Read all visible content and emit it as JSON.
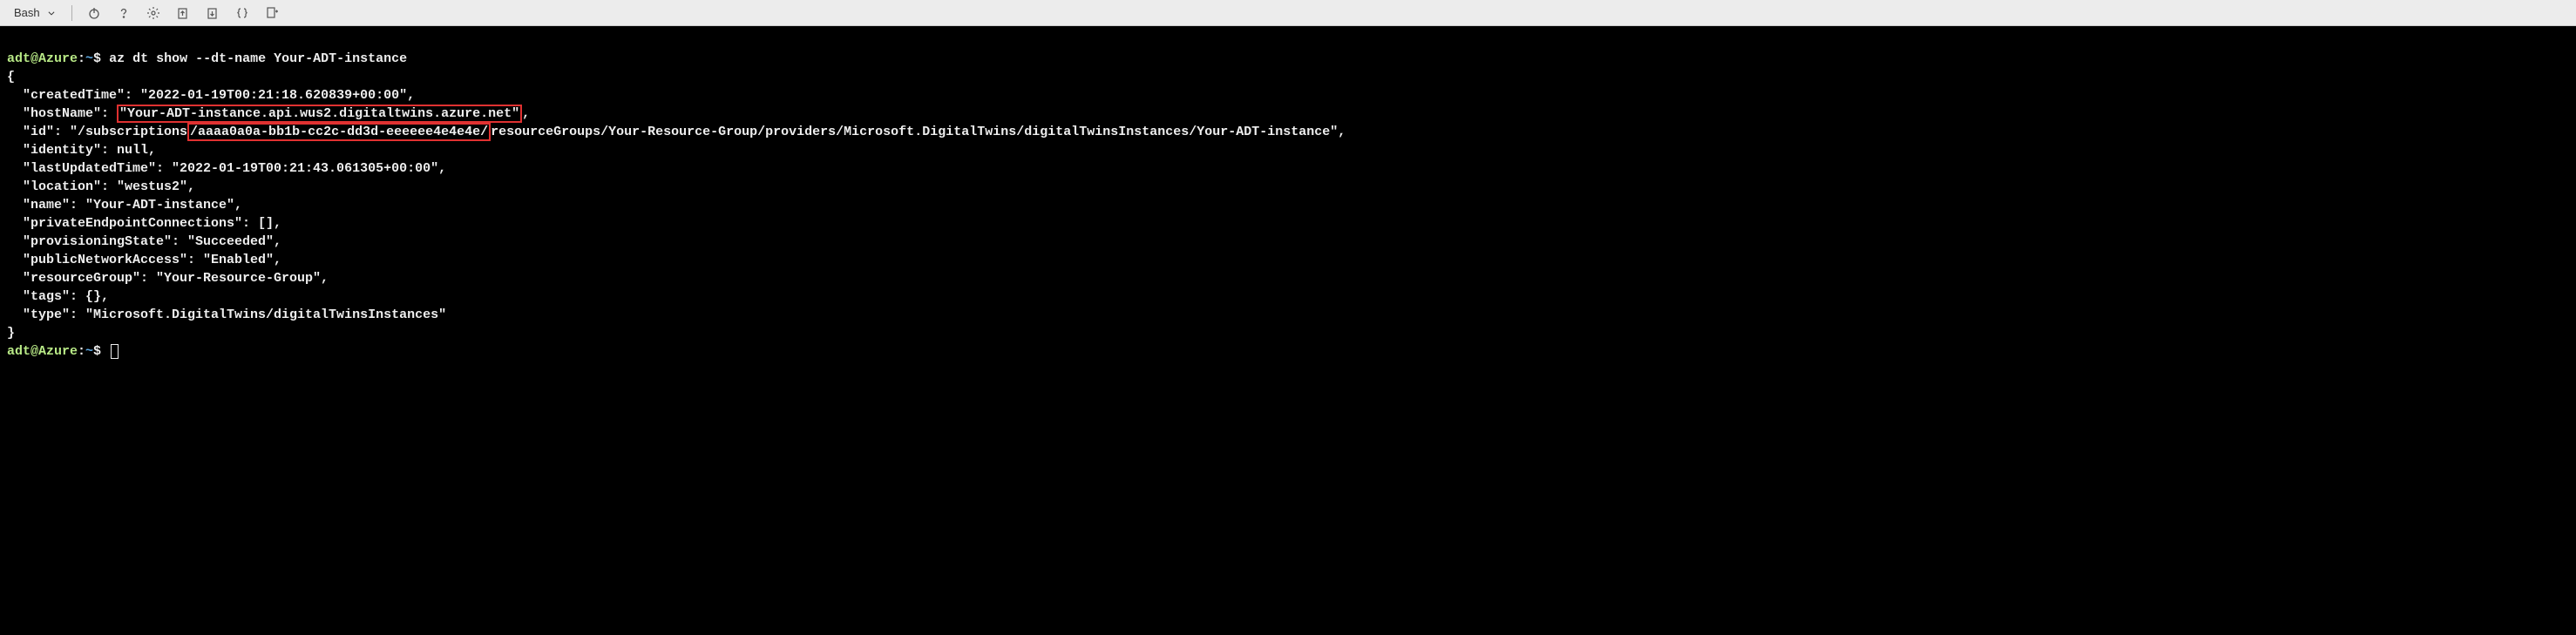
{
  "toolbar": {
    "shell_label": "Bash"
  },
  "prompt": {
    "user": "adt@Azure",
    "path": "~",
    "symbol": "$",
    "colon": ":"
  },
  "command": "az dt show --dt-name Your-ADT-instance",
  "json_open": "{",
  "json_close": "}",
  "lines": {
    "createdTime_key": "  \"createdTime\": ",
    "createdTime_val": "\"2022-01-19T00:21:18.620839+00:00\",",
    "hostName_key": "  \"hostName\": ",
    "hostName_hl": "\"Your-ADT-instance.api.wus2.digitaltwins.azure.net\"",
    "hostName_end": ",",
    "id_key": "  \"id\": \"/subscriptions",
    "id_hl": "/aaaa0a0a-bb1b-cc2c-dd3d-eeeeee4e4e4e/",
    "id_rest": "resourceGroups/Your-Resource-Group/providers/Microsoft.DigitalTwins/digitalTwinsInstances/Your-ADT-instance\",",
    "identity": "  \"identity\": null,",
    "lastUpdatedTime": "  \"lastUpdatedTime\": \"2022-01-19T00:21:43.061305+00:00\",",
    "location": "  \"location\": \"westus2\",",
    "name": "  \"name\": \"Your-ADT-instance\",",
    "privateEndpointConnections": "  \"privateEndpointConnections\": [],",
    "provisioningState": "  \"provisioningState\": \"Succeeded\",",
    "publicNetworkAccess": "  \"publicNetworkAccess\": \"Enabled\",",
    "resourceGroup": "  \"resourceGroup\": \"Your-Resource-Group\",",
    "tags": "  \"tags\": {},",
    "type": "  \"type\": \"Microsoft.DigitalTwins/digitalTwinsInstances\""
  }
}
